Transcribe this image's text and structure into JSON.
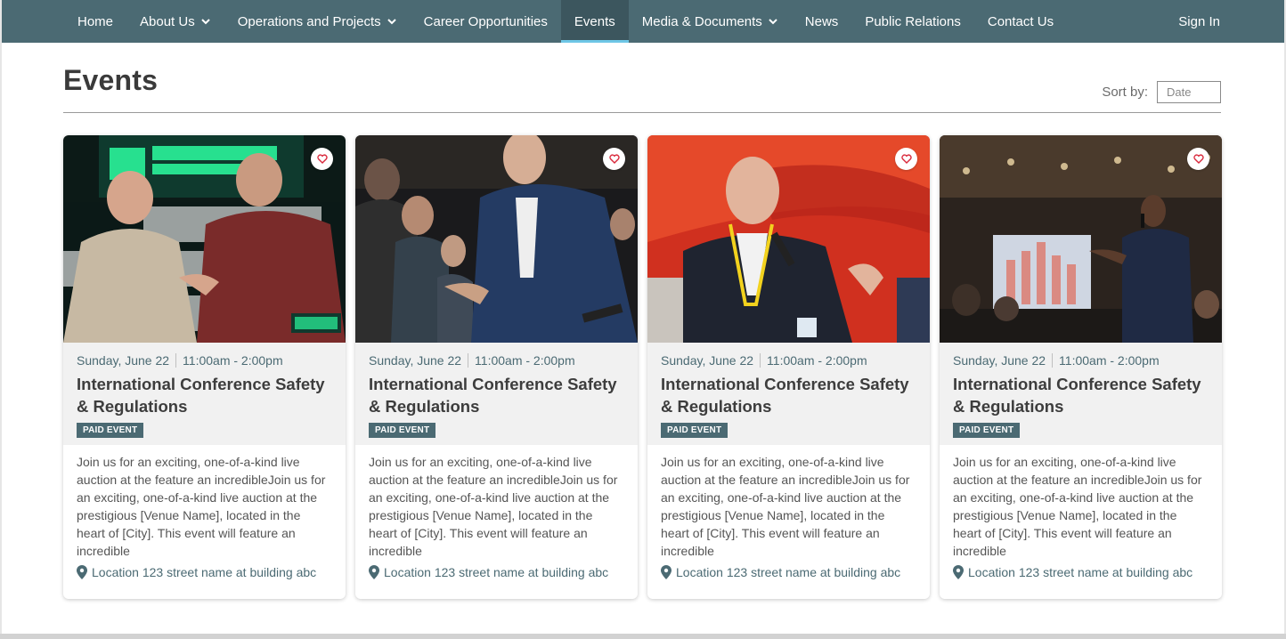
{
  "nav": {
    "items": [
      {
        "label": "Home",
        "dropdown": false,
        "active": false
      },
      {
        "label": "About Us",
        "dropdown": true,
        "active": false
      },
      {
        "label": "Operations and Projects",
        "dropdown": true,
        "active": false
      },
      {
        "label": "Career Opportunities",
        "dropdown": false,
        "active": false
      },
      {
        "label": "Events",
        "dropdown": false,
        "active": true
      },
      {
        "label": "Media & Documents",
        "dropdown": true,
        "active": false
      },
      {
        "label": "News",
        "dropdown": false,
        "active": false
      },
      {
        "label": "Public Relations",
        "dropdown": false,
        "active": false
      },
      {
        "label": "Contact Us",
        "dropdown": false,
        "active": false
      }
    ],
    "signin_label": "Sign In"
  },
  "header": {
    "title": "Events",
    "sort_label": "Sort by:",
    "sort_value": "Date"
  },
  "colors": {
    "nav_bg": "#4b6a73",
    "accent_underline": "#6ec6e6",
    "badge_bg": "#4b6a73",
    "heart": "#d9283b"
  },
  "cards": [
    {
      "image_icon": "photo-handshake-mining-expo",
      "date": "Sunday, June 22",
      "time": "11:00am - 2:00pm",
      "title": "International Conference Safety & Regulations",
      "badge": "PAID EVENT",
      "description": "Join us for an exciting, one-of-a-kind live auction at the feature an incredibleJoin us for an exciting, one-of-a-kind live auction at the prestigious [Venue Name], located in the heart of [City]. This event will feature an incredible",
      "location": "Location 123 street name at building abc"
    },
    {
      "image_icon": "photo-handshake-crowd",
      "date": "Sunday, June 22",
      "time": "11:00am - 2:00pm",
      "title": "International Conference Safety & Regulations",
      "badge": "PAID EVENT",
      "description": "Join us for an exciting, one-of-a-kind live auction at the feature an incredibleJoin us for an exciting, one-of-a-kind live auction at the prestigious [Venue Name], located in the heart of [City]. This event will feature an incredible",
      "location": "Location 123 street name at building abc"
    },
    {
      "image_icon": "photo-speaker-red-backdrop",
      "date": "Sunday, June 22",
      "time": "11:00am - 2:00pm",
      "title": "International Conference Safety & Regulations",
      "badge": "PAID EVENT",
      "description": "Join us for an exciting, one-of-a-kind live auction at the feature an incredibleJoin us for an exciting, one-of-a-kind live auction at the prestigious [Venue Name], located in the heart of [City]. This event will feature an incredible",
      "location": "Location 123 street name at building abc"
    },
    {
      "image_icon": "photo-speaker-ballroom",
      "date": "Sunday, June 22",
      "time": "11:00am - 2:00pm",
      "title": "International Conference Safety & Regulations",
      "badge": "PAID EVENT",
      "description": "Join us for an exciting, one-of-a-kind live auction at the feature an incredibleJoin us for an exciting, one-of-a-kind live auction at the prestigious [Venue Name], located in the heart of [City]. This event will feature an incredible",
      "location": "Location 123 street name at building abc"
    }
  ]
}
